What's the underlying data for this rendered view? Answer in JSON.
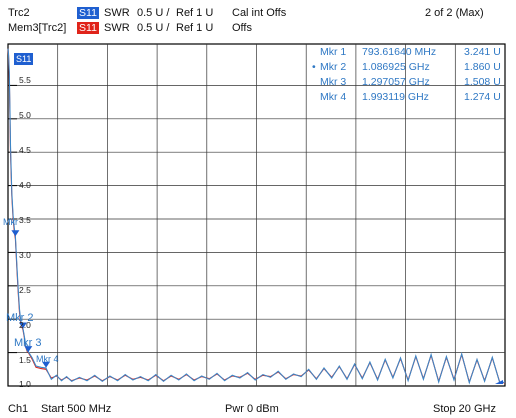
{
  "header": {
    "trace_name": "Trc2",
    "trace_badge": "S11",
    "trace_format": "SWR",
    "trace_scale": "0.5 U /",
    "trace_ref": "Ref 1 U",
    "cal_status": "Cal int Offs",
    "page_indicator": "2 of 2 (Max)",
    "memory_name": "Mem3[Trc2]",
    "memory_badge": "S11",
    "memory_format": "SWR",
    "memory_scale": "0.5 U /",
    "memory_ref": "Ref 1 U",
    "memory_offset": "Offs",
    "colors": {
      "trace": "#3d86c6",
      "memory": "#e0241a",
      "badge_blue": "#1f5fd0",
      "badge_red": "#e0241a"
    }
  },
  "y_axis": {
    "ticks": [
      "5.5",
      "5.0",
      "4.5",
      "4.0",
      "3.5",
      "3.0",
      "2.5",
      "2.0",
      "1.5",
      "1.0"
    ],
    "top_label": "S11"
  },
  "markers": {
    "table": [
      {
        "name": "Mkr 1",
        "freq": "793.61640 MHz",
        "value": "3.241  U",
        "active": false
      },
      {
        "name": "Mkr 2",
        "freq": "1.086925 GHz",
        "value": "1.860  U",
        "active": true
      },
      {
        "name": "Mkr 3",
        "freq": "1.297057 GHz",
        "value": "1.508  U",
        "active": false
      },
      {
        "name": "Mkr 4",
        "freq": "1.993119 GHz",
        "value": "1.274  U",
        "active": false
      }
    ],
    "active_bullet": "•",
    "labels": {
      "m1": "Mkr",
      "m2": "Mkr 2",
      "m3": "Mkr 3",
      "m4": "Mkr 4"
    }
  },
  "footer": {
    "channel": "Ch1",
    "start": "Start  500 MHz",
    "power": "Pwr  0 dBm",
    "stop": "Stop  20 GHz"
  },
  "chart_data": {
    "type": "line",
    "x_unit": "GHz",
    "xlim": [
      0.5,
      20
    ],
    "ylim": [
      1.0,
      6.0
    ],
    "y_unit": "U",
    "grid": true,
    "series": [
      {
        "name": "Trc2",
        "x": [
          0.5,
          0.52,
          0.55,
          0.58,
          0.6,
          0.65,
          0.7,
          0.75,
          0.79,
          0.85,
          0.9,
          0.95,
          1.0,
          1.05,
          1.09,
          1.15,
          1.2,
          1.25,
          1.3,
          1.45,
          1.6,
          1.8,
          1.99,
          2.2,
          2.4,
          2.6,
          2.8,
          3.0,
          3.3,
          3.6,
          3.9,
          4.2,
          4.5,
          4.8,
          5.1,
          5.4,
          5.7,
          6.0,
          6.3,
          6.6,
          6.9,
          7.2,
          7.5,
          7.8,
          8.1,
          8.4,
          8.7,
          9.0,
          9.3,
          9.6,
          9.9,
          10.2,
          10.5,
          10.8,
          11.1,
          11.4,
          11.7,
          12.0,
          12.3,
          12.6,
          12.9,
          13.2,
          13.5,
          13.8,
          14.1,
          14.4,
          14.7,
          15.0,
          15.3,
          15.6,
          15.9,
          16.2,
          16.5,
          16.8,
          17.1,
          17.4,
          17.7,
          18.0,
          18.3,
          18.6,
          18.9,
          19.2,
          19.5,
          19.8,
          20.0
        ],
        "y": [
          6.05,
          5.98,
          5.7,
          5.1,
          4.6,
          3.9,
          3.55,
          3.35,
          3.24,
          2.8,
          2.45,
          2.15,
          1.98,
          1.9,
          1.86,
          1.72,
          1.6,
          1.53,
          1.51,
          1.42,
          1.3,
          1.28,
          1.27,
          1.1,
          1.16,
          1.08,
          1.14,
          1.07,
          1.13,
          1.08,
          1.16,
          1.07,
          1.15,
          1.08,
          1.17,
          1.09,
          1.14,
          1.08,
          1.17,
          1.07,
          1.16,
          1.09,
          1.18,
          1.08,
          1.15,
          1.1,
          1.19,
          1.08,
          1.16,
          1.12,
          1.2,
          1.09,
          1.17,
          1.13,
          1.22,
          1.1,
          1.18,
          1.14,
          1.25,
          1.1,
          1.27,
          1.12,
          1.3,
          1.1,
          1.33,
          1.11,
          1.36,
          1.09,
          1.4,
          1.12,
          1.42,
          1.08,
          1.45,
          1.1,
          1.47,
          1.06,
          1.44,
          1.09,
          1.48,
          1.05,
          1.4,
          1.07,
          1.43,
          1.04,
          1.06
        ]
      },
      {
        "name": "Mem3[Trc2]",
        "x": [
          0.5,
          0.52,
          0.55,
          0.58,
          0.6,
          0.65,
          0.7,
          0.75,
          0.79,
          0.85,
          0.9,
          0.95,
          1.0,
          1.05,
          1.09,
          1.15,
          1.2,
          1.25,
          1.3,
          1.45,
          1.6,
          1.8,
          1.99,
          2.2,
          2.4,
          2.6,
          2.8,
          3.0,
          3.3,
          3.6,
          3.9,
          4.2,
          4.5,
          4.8,
          5.1,
          5.4,
          5.7,
          6.0,
          6.3,
          6.6,
          6.9,
          7.2,
          7.5,
          7.8,
          8.1,
          8.4,
          8.7,
          9.0,
          9.3,
          9.6,
          9.9,
          10.2,
          10.5,
          10.8,
          11.1,
          11.4,
          11.7,
          12.0,
          12.3,
          12.6,
          12.9,
          13.2,
          13.5,
          13.8,
          14.1,
          14.4,
          14.7,
          15.0,
          15.3,
          15.6,
          15.9,
          16.2,
          16.5,
          16.8,
          17.1,
          17.4,
          17.7,
          18.0,
          18.3,
          18.6,
          18.9,
          19.2,
          19.5,
          19.8,
          20.0
        ],
        "y": [
          6.05,
          5.95,
          5.6,
          5.0,
          4.5,
          3.85,
          3.5,
          3.3,
          3.2,
          2.75,
          2.4,
          2.1,
          1.95,
          1.88,
          1.84,
          1.7,
          1.58,
          1.52,
          1.5,
          1.4,
          1.28,
          1.26,
          1.25,
          1.12,
          1.15,
          1.09,
          1.13,
          1.08,
          1.12,
          1.09,
          1.15,
          1.08,
          1.14,
          1.09,
          1.16,
          1.1,
          1.13,
          1.09,
          1.16,
          1.08,
          1.15,
          1.1,
          1.17,
          1.09,
          1.14,
          1.11,
          1.18,
          1.09,
          1.15,
          1.13,
          1.19,
          1.1,
          1.16,
          1.14,
          1.21,
          1.11,
          1.17,
          1.15,
          1.24,
          1.11,
          1.26,
          1.13,
          1.29,
          1.11,
          1.32,
          1.12,
          1.35,
          1.1,
          1.39,
          1.13,
          1.41,
          1.09,
          1.44,
          1.11,
          1.46,
          1.07,
          1.43,
          1.1,
          1.47,
          1.06,
          1.39,
          1.08,
          1.42,
          1.05,
          1.05
        ]
      }
    ]
  }
}
